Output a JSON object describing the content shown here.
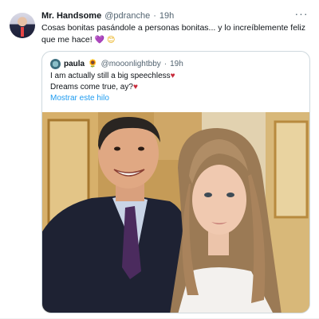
{
  "tweet": {
    "author_name": "Mr. Handsome",
    "author_handle": "@pdranche",
    "separator": "·",
    "time": "19h",
    "more_label": "···",
    "text": "Cosas bonitas pasándole a personas bonitas... y lo increíblemente feliz que me hace!",
    "emoji_heart": "💜",
    "emoji_smile": "😊"
  },
  "quote": {
    "author_name": "paula",
    "author_emoji": "🌻",
    "author_handle": "@mooonlightbby",
    "separator": "·",
    "time": "19h",
    "line1": "I am actually still a big speechless",
    "line2": "Dreams come true, ay?",
    "heart": "♥",
    "show_thread": "Mostrar este hilo",
    "photo_icon": "selfie-photo"
  },
  "colors": {
    "link": "#1d9bf0",
    "secondary_text": "#536471",
    "border": "#cfd9de"
  }
}
